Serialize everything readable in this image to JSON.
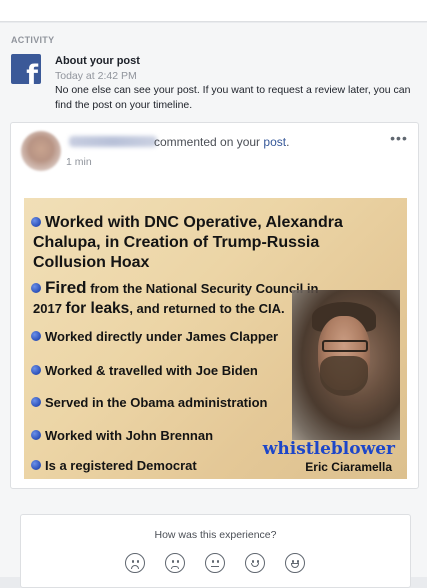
{
  "activity": {
    "heading": "ACTIVITY",
    "icon": "facebook-logo-icon",
    "notification": {
      "title": "About your post",
      "time": "Today at 2:42 PM",
      "text": "No one else can see your post. If you want to request a review later, you can find the post on your timeline."
    }
  },
  "post": {
    "commented_text": "commented on your",
    "post_link": "post",
    "post_link_suffix": ".",
    "time": "1 min",
    "more_icon": "more-horizontal-icon",
    "meme": {
      "lines": [
        "Worked with DNC Operative, Alexandra",
        "Chalupa, in Creation of Trump-Russia",
        "Collusion Hoax",
        "Fired",
        "from the National Security Council in",
        "2017",
        "for leaks",
        ", and returned to the CIA.",
        "Worked directly under James Clapper",
        "Worked & travelled with Joe Biden",
        "Served in the Obama administration",
        "Worked with John Brennan",
        "Is a registered Democrat"
      ],
      "caption_title": "whistleblower",
      "caption_name": "Eric Ciaramella"
    }
  },
  "feedback": {
    "question": "How was this experience?",
    "faces": [
      "very-sad-face-icon",
      "sad-face-icon",
      "neutral-face-icon",
      "happy-face-icon",
      "very-happy-face-icon"
    ]
  },
  "colors": {
    "facebook_blue": "#3b5998",
    "link_blue": "#365899",
    "background": "#e9ebee",
    "whistleblower_blue": "#1d46c9"
  }
}
